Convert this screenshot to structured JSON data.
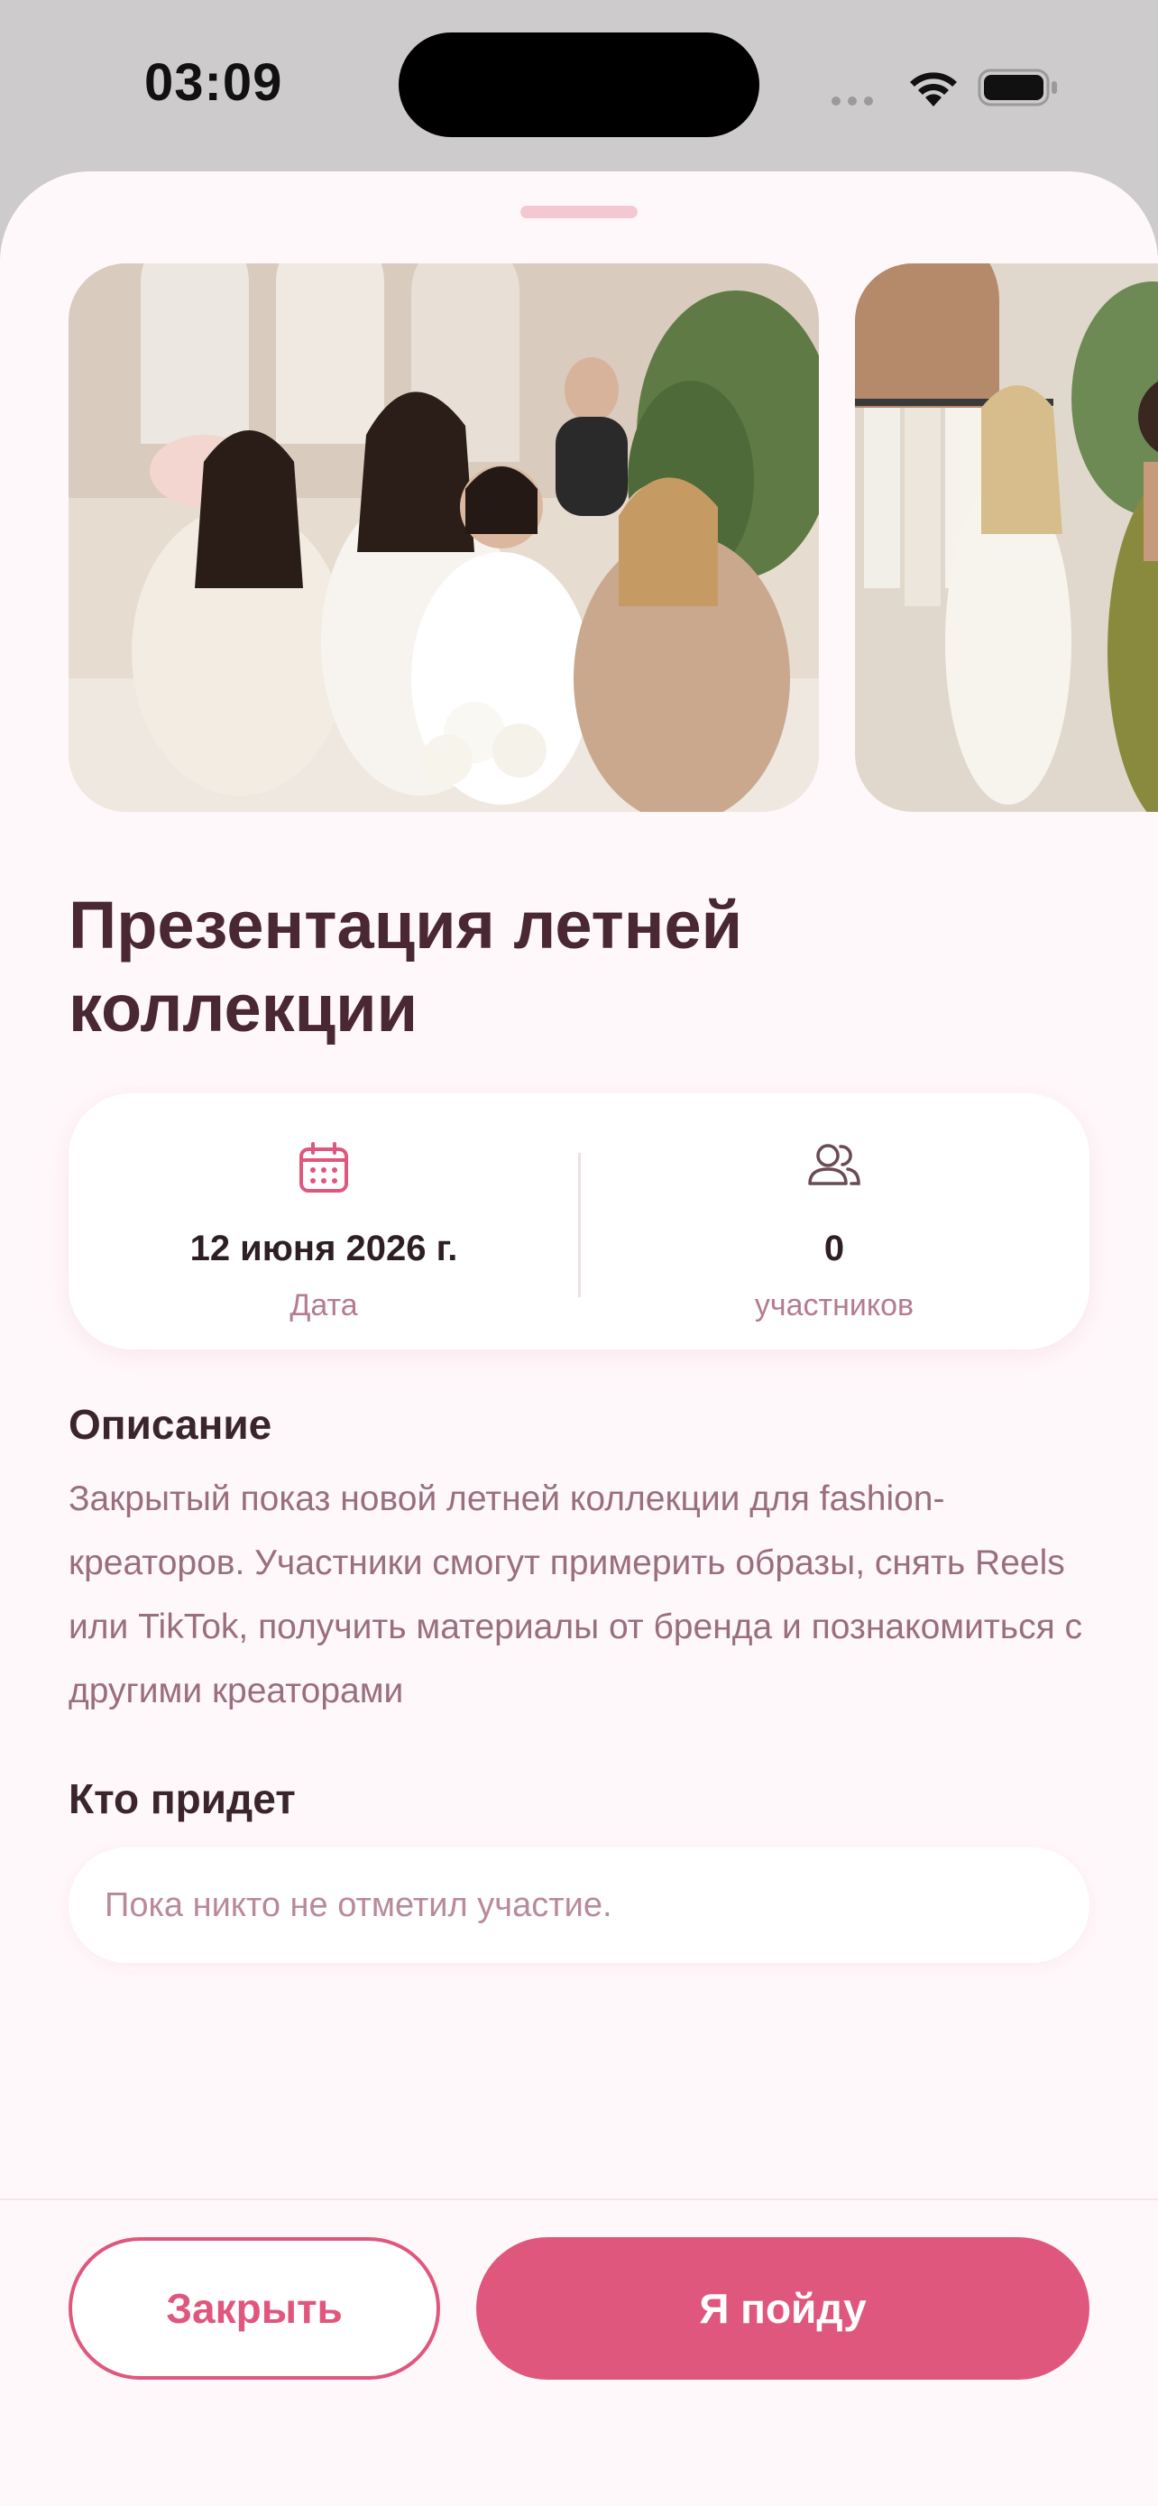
{
  "status_bar": {
    "time": "03:09"
  },
  "event": {
    "title": "Презентация летней коллекции",
    "stats": {
      "date_value": "12 июня 2026 г.",
      "date_label": "Дата",
      "participants_value": "0",
      "participants_label": "участников"
    },
    "description_title": "Описание",
    "description": "Закрытый показ новой летней коллекции для fashion-креаторов. Участники смогут примерить образы, снять Reels или TikTok, получить материалы от бренда и познакомиться с другими креаторами",
    "attendees_title": "Кто придет",
    "attendees_empty": "Пока никто не отметил участие."
  },
  "buttons": {
    "close": "Закрыть",
    "go": "Я пойду"
  },
  "icons": {
    "date": "calendar-icon",
    "participants": "people-icon",
    "wifi": "wifi-icon",
    "battery": "battery-icon"
  },
  "colors": {
    "accent": "#e0577e",
    "title": "#4a2833",
    "muted": "#9a6f7d",
    "sheet_bg": "#fff8fa"
  }
}
